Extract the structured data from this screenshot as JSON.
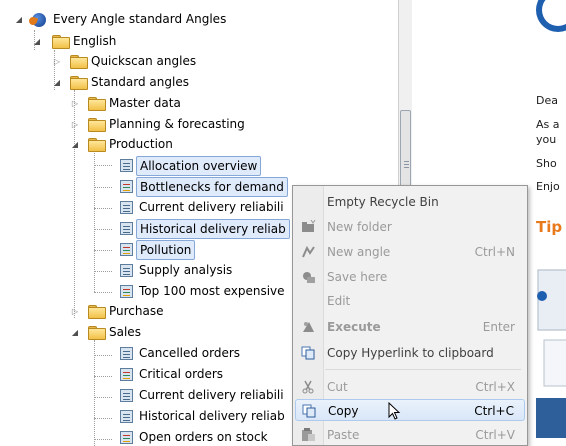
{
  "tree": {
    "root": "Every Angle standard Angles",
    "language": "English",
    "quickscan": "Quickscan angles",
    "standard": "Standard angles",
    "master_data": "Master data",
    "planning": "Planning & forecasting",
    "production": "Production",
    "production_items": [
      "Allocation overview",
      "Bottlenecks for demand",
      "Current delivery reliabili",
      "Historical delivery reliab",
      "Pollution",
      "Supply analysis",
      "Top 100 most expensive"
    ],
    "purchase": "Purchase",
    "sales": "Sales",
    "sales_items": [
      "Cancelled orders",
      "Critical orders",
      "Current delivery reliabili",
      "Historical delivery reliab",
      "Open orders on stock"
    ]
  },
  "right_panel": {
    "lines": [
      "Dea",
      "As a",
      "you",
      "Sho",
      "Enjo"
    ],
    "tips_heading": "Tip"
  },
  "context_menu": {
    "items": [
      {
        "label": "Empty Recycle Bin",
        "shortcut": "",
        "icon": "",
        "disabled": false
      },
      {
        "label": "New folder",
        "shortcut": "",
        "icon": "new-folder-icon",
        "disabled": true
      },
      {
        "label": "New angle",
        "shortcut": "Ctrl+N",
        "icon": "new-angle-icon",
        "disabled": true
      },
      {
        "label": "Save here",
        "shortcut": "",
        "icon": "save-here-icon",
        "disabled": true
      },
      {
        "label": "Edit",
        "shortcut": "",
        "icon": "",
        "disabled": true
      },
      {
        "label": "Execute",
        "shortcut": "Enter",
        "icon": "execute-icon",
        "disabled": true
      },
      {
        "label": "Copy Hyperlink to clipboard",
        "shortcut": "",
        "icon": "copy-hyperlink-icon",
        "disabled": false
      },
      {
        "label": "Cut",
        "shortcut": "Ctrl+X",
        "icon": "scissors-icon",
        "disabled": true
      },
      {
        "label": "Copy",
        "shortcut": "Ctrl+C",
        "icon": "copy-icon",
        "disabled": false,
        "highlighted": true
      },
      {
        "label": "Paste",
        "shortcut": "Ctrl+V",
        "icon": "paste-icon",
        "disabled": true
      }
    ]
  }
}
